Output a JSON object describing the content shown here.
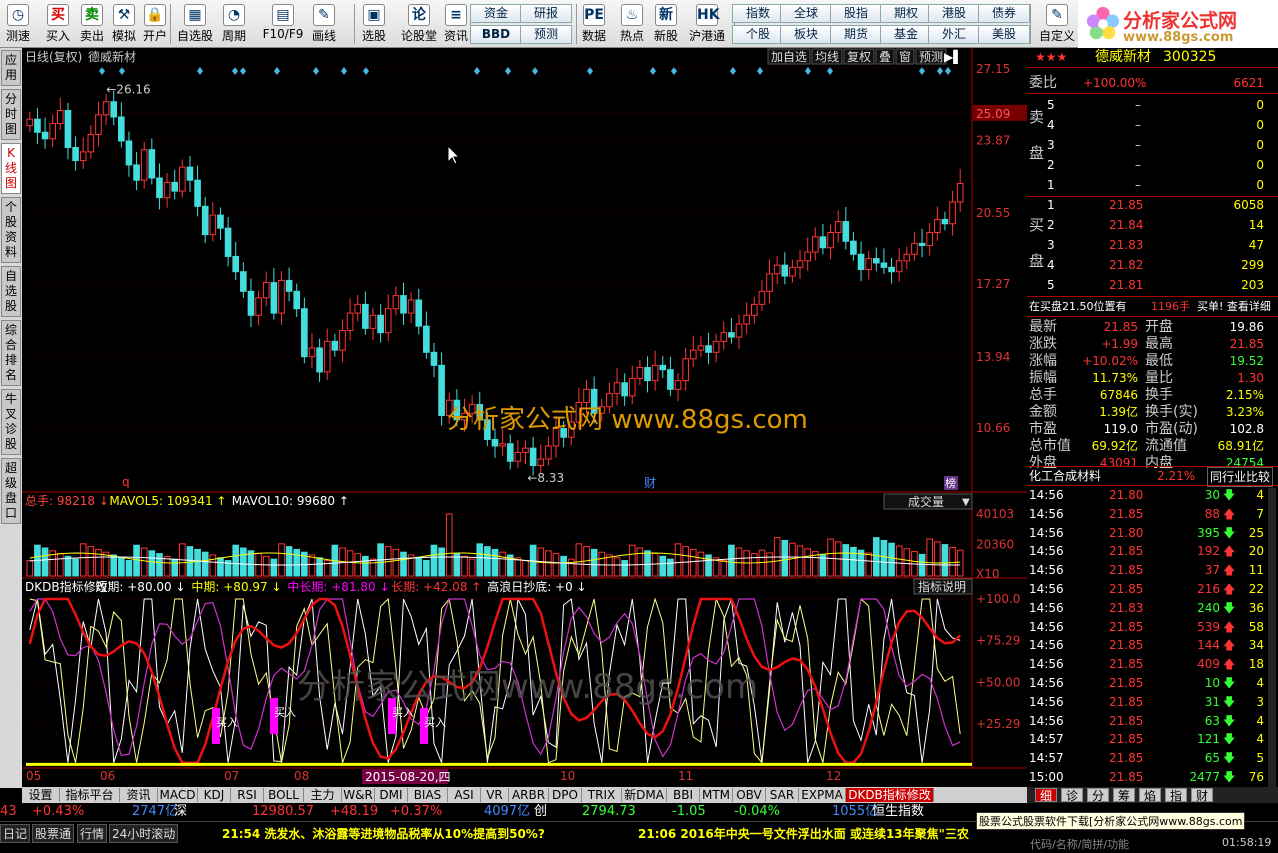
{
  "toolbar": {
    "buttons": [
      {
        "label": "测速",
        "icon": "clock-icon",
        "glyph": "◷"
      },
      {
        "label": "买入",
        "icon": "buy-icon",
        "glyph": "买",
        "color": "#d00"
      },
      {
        "label": "卖出",
        "icon": "sell-icon",
        "glyph": "卖",
        "color": "#080"
      },
      {
        "label": "模拟",
        "icon": "hammer-icon",
        "glyph": "⚒"
      },
      {
        "label": "开户",
        "icon": "lock-icon",
        "glyph": "🔒"
      },
      {
        "label": "自选股",
        "icon": "grid-icon",
        "glyph": "▦"
      },
      {
        "label": "周期",
        "icon": "cycle-icon",
        "glyph": "◔"
      },
      {
        "label": "F10/F9",
        "icon": "f10-icon",
        "glyph": "▤"
      },
      {
        "label": "画线",
        "icon": "pen-icon",
        "glyph": "✎"
      },
      {
        "label": "选股",
        "icon": "select-icon",
        "glyph": "▣"
      },
      {
        "label": "论股堂",
        "icon": "forum-icon",
        "glyph": "论"
      },
      {
        "label": "资讯",
        "icon": "news-icon",
        "glyph": "≡"
      },
      {
        "label": "数据",
        "icon": "pe-icon",
        "glyph": "PE"
      },
      {
        "label": "热点",
        "icon": "hot-icon",
        "glyph": "♨"
      },
      {
        "label": "新股",
        "icon": "ipo-icon",
        "glyph": "新"
      },
      {
        "label": "沪港通",
        "icon": "hk-icon",
        "glyph": "HK"
      },
      {
        "label": "自定义",
        "icon": "custom-icon",
        "glyph": "✎"
      }
    ],
    "quick": [
      [
        "资金",
        "BBD"
      ],
      [
        "研报",
        "预测"
      ],
      [
        "指数",
        "个股"
      ],
      [
        "全球",
        "板块"
      ],
      [
        "股指",
        "期货"
      ],
      [
        "期权",
        "基金"
      ],
      [
        "港股",
        "外汇"
      ],
      [
        "债券",
        "美股"
      ]
    ]
  },
  "logo": {
    "line1": "分析家公式网",
    "line2": "www.88gs.com"
  },
  "left_tabs": [
    "应用",
    "分时图",
    "K线图",
    "个股资料",
    "自选股",
    "综合排名",
    "牛叉诊股",
    "超级盘口"
  ],
  "chart": {
    "header_left": "日线(复权)",
    "stock_name": "德威新材",
    "header_buttons": [
      "加自选",
      "均线",
      "复权",
      "叠",
      "窗",
      "预测"
    ],
    "price_ticks": [
      "27.15",
      "25.09",
      "23.87",
      "20.55",
      "17.27",
      "13.94",
      "10.66"
    ],
    "high_label": "26.16",
    "low_label": "8.33",
    "markers": [
      "q",
      "财",
      "榜"
    ],
    "watermark": "分析家公式网 www.88gs.com",
    "vol_header": [
      {
        "text": "总手: 98218",
        "color": "#f44"
      },
      {
        "text": "MAVOL5: 109341",
        "color": "#ff0"
      },
      {
        "text": "MAVOL10: 99680",
        "color": "#fff"
      }
    ],
    "vol_select": "成交量",
    "vol_ticks": [
      "40103",
      "20360",
      "X10"
    ],
    "ind_header": [
      {
        "text": "DKDB指标修改",
        "color": "#fff"
      },
      {
        "text": "短期: +80.00",
        "color": "#fff"
      },
      {
        "text": "中期: +80.97",
        "color": "#ff0"
      },
      {
        "text": "中长期: +81.80",
        "color": "#f0f"
      },
      {
        "text": "长期: +42.08",
        "color": "#f33"
      },
      {
        "text": "高浪日抄底: +0",
        "color": "#fff"
      }
    ],
    "ind_button": "指标说明",
    "ind_ticks": [
      "+100.0",
      "+75.29",
      "+50.00",
      "+25.29"
    ],
    "buy_signal": "买入",
    "x_labels": [
      "05",
      "06",
      "07",
      "08",
      "10",
      "11",
      "12"
    ],
    "date_label": "2015-08-20,四",
    "ind_watermark": "分析家公式网www.88gs.com"
  },
  "chart_data": {
    "type": "candlestick",
    "title": "德威新材 日线(复权)",
    "ylim": [
      8.33,
      27.15
    ],
    "high": 26.16,
    "low": 8.33,
    "close_series": [
      24.8,
      24.2,
      23.9,
      24.6,
      25.2,
      23.5,
      22.9,
      23.3,
      24.1,
      25.0,
      25.6,
      24.9,
      23.8,
      22.7,
      22.0,
      23.4,
      22.1,
      21.2,
      21.9,
      21.5,
      22.6,
      22.0,
      20.8,
      19.5,
      20.4,
      19.8,
      18.5,
      17.8,
      16.9,
      15.8,
      16.6,
      17.3,
      15.9,
      17.4,
      16.9,
      16.1,
      13.9,
      14.3,
      13.2,
      14.6,
      14.2,
      15.1,
      15.9,
      16.3,
      15.2,
      15.8,
      15.0,
      16.1,
      16.7,
      15.9,
      16.5,
      15.3,
      14.1,
      13.5,
      11.2,
      11.9,
      11.0,
      11.3,
      11.7,
      11.0,
      10.1,
      9.8,
      9.9,
      9.1,
      9.5,
      9.7,
      8.9,
      9.2,
      9.8,
      10.6,
      10.2,
      10.9,
      11.8,
      12.4,
      11.3,
      11.6,
      12.2,
      12.7,
      12.1,
      12.9,
      13.4,
      12.8,
      13.5,
      13.3,
      12.4,
      12.8,
      13.8,
      14.2,
      14.4,
      14.1,
      14.6,
      15.0,
      14.8,
      15.4,
      15.8,
      16.3,
      16.9,
      17.7,
      18.1,
      17.6,
      18.0,
      18.3,
      18.7,
      19.4,
      18.9,
      19.6,
      20.1,
      19.2,
      18.6,
      17.9,
      18.4,
      18.2,
      18.0,
      17.8,
      18.3,
      18.6,
      19.1,
      19.0,
      19.6,
      20.2,
      20.0,
      21.0,
      21.85
    ],
    "volume_ylim": [
      0,
      40103
    ],
    "volume": {
      "total": 98218,
      "mavol5": 109341,
      "mavol10": 99680
    },
    "indicator": {
      "name": "DKDB指标修改",
      "series": [
        {
          "name": "短期",
          "value": 80.0
        },
        {
          "name": "中期",
          "value": 80.97
        },
        {
          "name": "中长期",
          "value": 81.8
        },
        {
          "name": "长期",
          "value": 42.08
        },
        {
          "name": "高浪日抄底",
          "value": 0
        }
      ],
      "ylim": [
        0,
        100
      ]
    },
    "x_labels": [
      "05",
      "06",
      "07",
      "08",
      "10",
      "11",
      "12"
    ]
  },
  "quote": {
    "stars": "★★★",
    "name": "德威新材",
    "code": "300325",
    "weibi_label": "委比",
    "weibi": "+100.00%",
    "weicha": "6621",
    "sell_label": "卖盘",
    "buy_label": "买盘",
    "asks": [
      {
        "lvl": "5",
        "price": "–",
        "vol": "0"
      },
      {
        "lvl": "4",
        "price": "–",
        "vol": "0"
      },
      {
        "lvl": "3",
        "price": "–",
        "vol": "0"
      },
      {
        "lvl": "2",
        "price": "–",
        "vol": "0"
      },
      {
        "lvl": "1",
        "price": "–",
        "vol": "0"
      }
    ],
    "bids": [
      {
        "lvl": "1",
        "price": "21.85",
        "vol": "6058"
      },
      {
        "lvl": "2",
        "price": "21.84",
        "vol": "14"
      },
      {
        "lvl": "3",
        "price": "21.83",
        "vol": "47"
      },
      {
        "lvl": "4",
        "price": "21.82",
        "vol": "299"
      },
      {
        "lvl": "5",
        "price": "21.81",
        "vol": "203"
      }
    ],
    "notice": "在买盘21.50位置有",
    "notice_vol": "1196手",
    "notice_tail": "买单! 查看详细",
    "stats": [
      [
        "最新",
        "21.85",
        "#f33",
        "开盘",
        "19.86",
        "#fff"
      ],
      [
        "涨跌",
        "+1.99",
        "#f33",
        "最高",
        "21.85",
        "#f33"
      ],
      [
        "涨幅",
        "+10.02%",
        "#f33",
        "最低",
        "19.52",
        "#3f3"
      ],
      [
        "振幅",
        "11.73%",
        "#ff0",
        "量比",
        "1.30",
        "#f33"
      ],
      [
        "总手",
        "67846",
        "#ff0",
        "换手",
        "2.15%",
        "#ff0"
      ],
      [
        "金额",
        "1.39亿",
        "#ff0",
        "换手(实)",
        "3.23%",
        "#ff0"
      ],
      [
        "市盈",
        "119.0",
        "#fff",
        "市盈(动)",
        "102.8",
        "#fff"
      ],
      [
        "总市值",
        "69.92亿",
        "#ff0",
        "流通值",
        "68.91亿",
        "#ff0"
      ],
      [
        "外盘",
        "43091",
        "#f33",
        "内盘",
        "24754",
        "#3f3"
      ]
    ],
    "sector": "化工合成材料",
    "sector_pct": "2.21%",
    "compare": "同行业比较",
    "ticks": [
      {
        "t": "14:56",
        "p": "21.80",
        "v": "30",
        "d": "down",
        "n": "4"
      },
      {
        "t": "14:56",
        "p": "21.85",
        "v": "88",
        "d": "up",
        "n": "7"
      },
      {
        "t": "14:56",
        "p": "21.80",
        "v": "395",
        "d": "down",
        "n": "25"
      },
      {
        "t": "14:56",
        "p": "21.85",
        "v": "192",
        "d": "up",
        "n": "20"
      },
      {
        "t": "14:56",
        "p": "21.85",
        "v": "37",
        "d": "up",
        "n": "11"
      },
      {
        "t": "14:56",
        "p": "21.85",
        "v": "216",
        "d": "up",
        "n": "22"
      },
      {
        "t": "14:56",
        "p": "21.83",
        "v": "240",
        "d": "down",
        "n": "36"
      },
      {
        "t": "14:56",
        "p": "21.85",
        "v": "539",
        "d": "up",
        "n": "58"
      },
      {
        "t": "14:56",
        "p": "21.85",
        "v": "144",
        "d": "up",
        "n": "34"
      },
      {
        "t": "14:56",
        "p": "21.85",
        "v": "409",
        "d": "up",
        "n": "18"
      },
      {
        "t": "14:56",
        "p": "21.85",
        "v": "10",
        "d": "down",
        "n": "4"
      },
      {
        "t": "14:56",
        "p": "21.85",
        "v": "31",
        "d": "down",
        "n": "3"
      },
      {
        "t": "14:56",
        "p": "21.85",
        "v": "63",
        "d": "down",
        "n": "4"
      },
      {
        "t": "14:57",
        "p": "21.85",
        "v": "121",
        "d": "down",
        "n": "4"
      },
      {
        "t": "14:57",
        "p": "21.85",
        "v": "65",
        "d": "down",
        "n": "5"
      },
      {
        "t": "15:00",
        "p": "21.85",
        "v": "2477",
        "d": "down",
        "n": "76"
      }
    ]
  },
  "bottom_tabs": [
    "设置",
    "指标平台",
    "资讯",
    "MACD",
    "KDJ",
    "RSI",
    "BOLL",
    "主力",
    "W&R",
    "DMI",
    "BIAS",
    "ASI",
    "VR",
    "ARBR",
    "DPO",
    "TRIX",
    "新DMA",
    "BBI",
    "MTM",
    "OBV",
    "SAR",
    "EXPMA",
    "DKDB指标修改"
  ],
  "right_tabs": [
    "细",
    "诊",
    "分",
    "筹",
    "焰",
    "指",
    "财"
  ],
  "status": [
    {
      "text": "43",
      "color": "#f33"
    },
    {
      "text": "+0.43%",
      "color": "#f33"
    },
    {
      "text": "2747亿",
      "color": "#48f"
    },
    {
      "text": "深",
      "color": "#fff"
    },
    {
      "text": "12980.57",
      "color": "#f33"
    },
    {
      "text": "+48.19",
      "color": "#f33"
    },
    {
      "text": "+0.37%",
      "color": "#f33"
    },
    {
      "text": "4097亿",
      "color": "#48f"
    },
    {
      "text": "创",
      "color": "#fff"
    },
    {
      "text": "2794.73",
      "color": "#3f3"
    },
    {
      "text": "-1.05",
      "color": "#3f3"
    },
    {
      "text": "-0.04%",
      "color": "#3f3"
    },
    {
      "text": "1055亿",
      "color": "#48f"
    },
    {
      "text": "恒生指数",
      "color": "#fff"
    }
  ],
  "news": {
    "tabs": [
      "日记",
      "股票通",
      "行情",
      "24小时滚动"
    ],
    "item1": "21:54 洗发水、沐浴露等进境物品税率从10%提高到50%?",
    "item2": "21:06 2016年中央一号文件浮出水面 或连续13年聚焦\"三农",
    "tooltip": "股票公式股票软件下载[分析家公式网www.88gs.com",
    "search": "代码/名称/简拼/功能",
    "clock": "01:58:19"
  }
}
